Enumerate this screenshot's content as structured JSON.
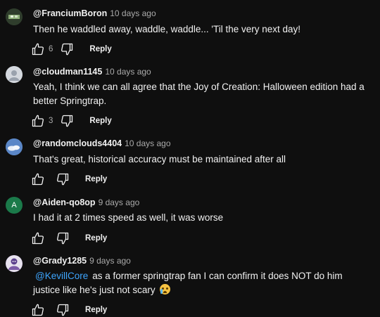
{
  "comments": [
    {
      "author": "@FranciumBoron",
      "time": "10 days ago",
      "text": "Then he waddled away, waddle, waddle... 'Til the very next day!",
      "likes": "6",
      "reply_label": "Reply",
      "avatar_letter": ""
    },
    {
      "author": "@cloudman1145",
      "time": "10 days ago",
      "text": "Yeah, I think we can all agree that the Joy of Creation: Halloween edition had a better Springtrap.",
      "likes": "3",
      "reply_label": "Reply",
      "avatar_letter": ""
    },
    {
      "author": "@randomclouds4404",
      "time": "10 days ago",
      "text": "That's great, historical accuracy must be maintained after all",
      "likes": "",
      "reply_label": "Reply",
      "avatar_letter": ""
    },
    {
      "author": "@Aiden-qo8op",
      "time": "9 days ago",
      "text": "I had it at 2 times speed as well, it was worse",
      "likes": "",
      "reply_label": "Reply",
      "avatar_letter": "A"
    },
    {
      "author": "@Grady1285",
      "time": "9 days ago",
      "mention": "@KevillCore",
      "text": "as a former springtrap fan I can confirm it does NOT do him justice like he's just not scary",
      "likes": "",
      "reply_label": "Reply",
      "avatar_letter": ""
    }
  ],
  "colors": {
    "background": "#0f0f0f",
    "text": "#f1f1f1",
    "secondary_text": "#aaaaaa",
    "mention": "#3ea6ff"
  },
  "icons": {
    "like": "thumbs-up-icon",
    "dislike": "thumbs-down-icon",
    "emoji": "loudly-crying-face-emoji"
  }
}
